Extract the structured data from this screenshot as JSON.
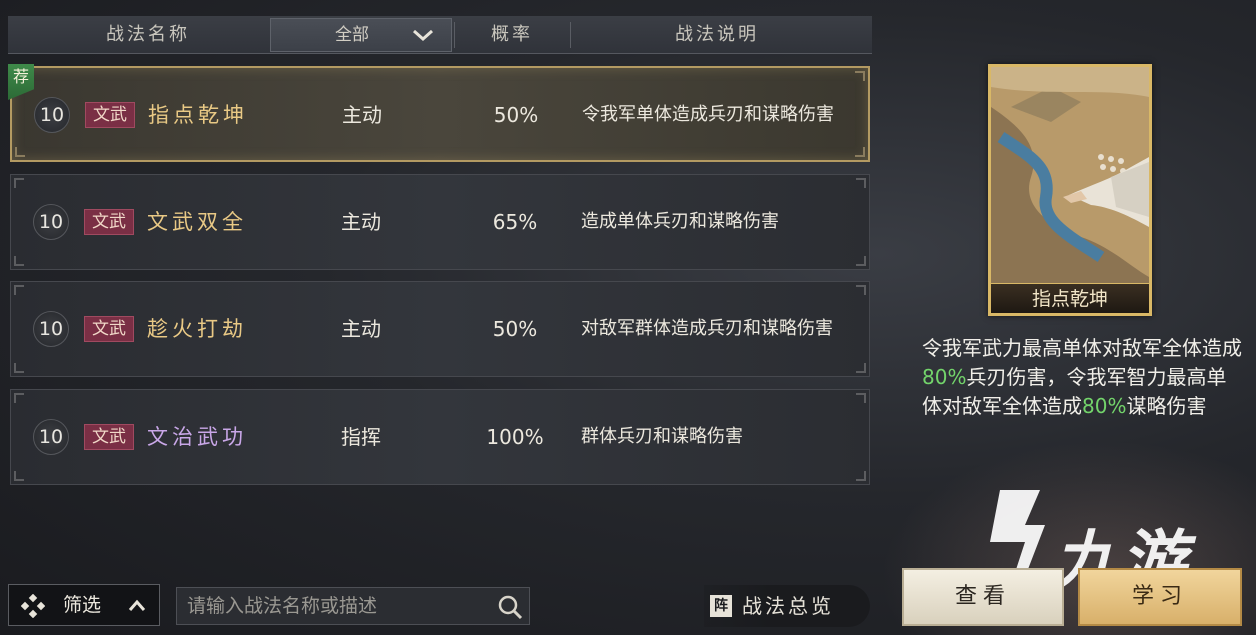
{
  "header": {
    "col_name": "战法名称",
    "filter_value": "全部",
    "col_rate": "概率",
    "col_desc": "战法说明"
  },
  "tactics": [
    {
      "level": "10",
      "type": "文武",
      "name": "指点乾坤",
      "kind": "主动",
      "rate": "50%",
      "desc": "令我军单体造成兵刃和谋略伤害",
      "name_color": "#e9c985",
      "recommended": "荐",
      "selected": true
    },
    {
      "level": "10",
      "type": "文武",
      "name": "文武双全",
      "kind": "主动",
      "rate": "65%",
      "desc": "造成单体兵刃和谋略伤害",
      "name_color": "#e9c985"
    },
    {
      "level": "10",
      "type": "文武",
      "name": "趁火打劫",
      "kind": "主动",
      "rate": "50%",
      "desc": "对敌军群体造成兵刃和谋略伤害",
      "name_color": "#e9c985"
    },
    {
      "level": "10",
      "type": "文武",
      "name": "文治武功",
      "kind": "指挥",
      "rate": "100%",
      "desc": "群体兵刃和谋略伤害",
      "name_color": "#c9a7e8"
    }
  ],
  "detail": {
    "card_name": "指点乾坤",
    "desc_parts": [
      "令我军武力最高单体对敌军全体造成",
      "80%",
      "兵刃伤害，令我军智力最高单体对敌军全体造成",
      "80%",
      "谋略伤害"
    ],
    "highlight_color": "#73d46b"
  },
  "bottom": {
    "filter_label": "筛选",
    "search_placeholder": "请输入战法名称或描述",
    "overview_icon": "阵",
    "overview_label": "战法总览",
    "view_label": "查看",
    "learn_label": "学习"
  },
  "watermark": {
    "text": "九游"
  }
}
